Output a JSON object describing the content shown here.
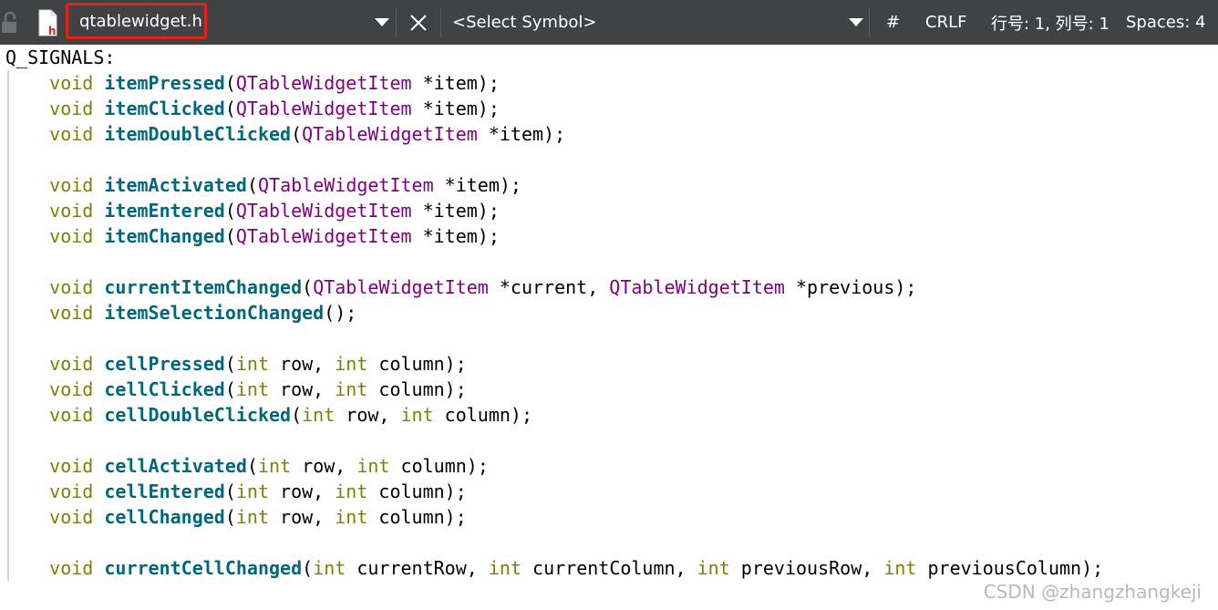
{
  "toolbar": {
    "file_name": "qtablewidget.h",
    "symbol_placeholder": "<Select Symbol>",
    "hash_label": "#",
    "line_ending": "CRLF",
    "cursor_position": "行号: 1, 列号: 1",
    "indentation": "Spaces: 4"
  },
  "code": {
    "label": "Q_SIGNALS:",
    "lines": [
      [
        {
          "t": "kw",
          "v": "void "
        },
        {
          "t": "fn",
          "v": "itemPressed"
        },
        {
          "t": "pl",
          "v": "("
        },
        {
          "t": "ty",
          "v": "QTableWidgetItem"
        },
        {
          "t": "pl",
          "v": " *item);"
        }
      ],
      [
        {
          "t": "kw",
          "v": "void "
        },
        {
          "t": "fn",
          "v": "itemClicked"
        },
        {
          "t": "pl",
          "v": "("
        },
        {
          "t": "ty",
          "v": "QTableWidgetItem"
        },
        {
          "t": "pl",
          "v": " *item);"
        }
      ],
      [
        {
          "t": "kw",
          "v": "void "
        },
        {
          "t": "fn",
          "v": "itemDoubleClicked"
        },
        {
          "t": "pl",
          "v": "("
        },
        {
          "t": "ty",
          "v": "QTableWidgetItem"
        },
        {
          "t": "pl",
          "v": " *item);"
        }
      ],
      [],
      [
        {
          "t": "kw",
          "v": "void "
        },
        {
          "t": "fn",
          "v": "itemActivated"
        },
        {
          "t": "pl",
          "v": "("
        },
        {
          "t": "ty",
          "v": "QTableWidgetItem"
        },
        {
          "t": "pl",
          "v": " *item);"
        }
      ],
      [
        {
          "t": "kw",
          "v": "void "
        },
        {
          "t": "fn",
          "v": "itemEntered"
        },
        {
          "t": "pl",
          "v": "("
        },
        {
          "t": "ty",
          "v": "QTableWidgetItem"
        },
        {
          "t": "pl",
          "v": " *item);"
        }
      ],
      [
        {
          "t": "kw",
          "v": "void "
        },
        {
          "t": "fn",
          "v": "itemChanged"
        },
        {
          "t": "pl",
          "v": "("
        },
        {
          "t": "ty",
          "v": "QTableWidgetItem"
        },
        {
          "t": "pl",
          "v": " *item);"
        }
      ],
      [],
      [
        {
          "t": "kw",
          "v": "void "
        },
        {
          "t": "fn",
          "v": "currentItemChanged"
        },
        {
          "t": "pl",
          "v": "("
        },
        {
          "t": "ty",
          "v": "QTableWidgetItem"
        },
        {
          "t": "pl",
          "v": " *current, "
        },
        {
          "t": "ty",
          "v": "QTableWidgetItem"
        },
        {
          "t": "pl",
          "v": " *previous);"
        }
      ],
      [
        {
          "t": "kw",
          "v": "void "
        },
        {
          "t": "fn",
          "v": "itemSelectionChanged"
        },
        {
          "t": "pl",
          "v": "();"
        }
      ],
      [],
      [
        {
          "t": "kw",
          "v": "void "
        },
        {
          "t": "fn",
          "v": "cellPressed"
        },
        {
          "t": "pl",
          "v": "("
        },
        {
          "t": "kw",
          "v": "int"
        },
        {
          "t": "pl",
          "v": " row, "
        },
        {
          "t": "kw",
          "v": "int"
        },
        {
          "t": "pl",
          "v": " column);"
        }
      ],
      [
        {
          "t": "kw",
          "v": "void "
        },
        {
          "t": "fn",
          "v": "cellClicked"
        },
        {
          "t": "pl",
          "v": "("
        },
        {
          "t": "kw",
          "v": "int"
        },
        {
          "t": "pl",
          "v": " row, "
        },
        {
          "t": "kw",
          "v": "int"
        },
        {
          "t": "pl",
          "v": " column);"
        }
      ],
      [
        {
          "t": "kw",
          "v": "void "
        },
        {
          "t": "fn",
          "v": "cellDoubleClicked"
        },
        {
          "t": "pl",
          "v": "("
        },
        {
          "t": "kw",
          "v": "int"
        },
        {
          "t": "pl",
          "v": " row, "
        },
        {
          "t": "kw",
          "v": "int"
        },
        {
          "t": "pl",
          "v": " column);"
        }
      ],
      [],
      [
        {
          "t": "kw",
          "v": "void "
        },
        {
          "t": "fn",
          "v": "cellActivated"
        },
        {
          "t": "pl",
          "v": "("
        },
        {
          "t": "kw",
          "v": "int"
        },
        {
          "t": "pl",
          "v": " row, "
        },
        {
          "t": "kw",
          "v": "int"
        },
        {
          "t": "pl",
          "v": " column);"
        }
      ],
      [
        {
          "t": "kw",
          "v": "void "
        },
        {
          "t": "fn",
          "v": "cellEntered"
        },
        {
          "t": "pl",
          "v": "("
        },
        {
          "t": "kw",
          "v": "int"
        },
        {
          "t": "pl",
          "v": " row, "
        },
        {
          "t": "kw",
          "v": "int"
        },
        {
          "t": "pl",
          "v": " column);"
        }
      ],
      [
        {
          "t": "kw",
          "v": "void "
        },
        {
          "t": "fn",
          "v": "cellChanged"
        },
        {
          "t": "pl",
          "v": "("
        },
        {
          "t": "kw",
          "v": "int"
        },
        {
          "t": "pl",
          "v": " row, "
        },
        {
          "t": "kw",
          "v": "int"
        },
        {
          "t": "pl",
          "v": " column);"
        }
      ],
      [],
      [
        {
          "t": "kw",
          "v": "void "
        },
        {
          "t": "fn",
          "v": "currentCellChanged"
        },
        {
          "t": "pl",
          "v": "("
        },
        {
          "t": "kw",
          "v": "int"
        },
        {
          "t": "pl",
          "v": " currentRow, "
        },
        {
          "t": "kw",
          "v": "int"
        },
        {
          "t": "pl",
          "v": " currentColumn, "
        },
        {
          "t": "kw",
          "v": "int"
        },
        {
          "t": "pl",
          "v": " previousRow, "
        },
        {
          "t": "kw",
          "v": "int"
        },
        {
          "t": "pl",
          "v": " previousColumn);"
        }
      ]
    ]
  },
  "watermark": "CSDN @zhangzhangkeji",
  "colors": {
    "toolbar_bg": "#404244",
    "highlight_box": "#e2231a",
    "keyword": "#808000",
    "function_name": "#00677c",
    "type_name": "#800080"
  },
  "icons": {
    "lock": "lock-icon",
    "file": "header-file-icon",
    "dropdown": "chevron-down-icon",
    "close": "close-icon"
  }
}
